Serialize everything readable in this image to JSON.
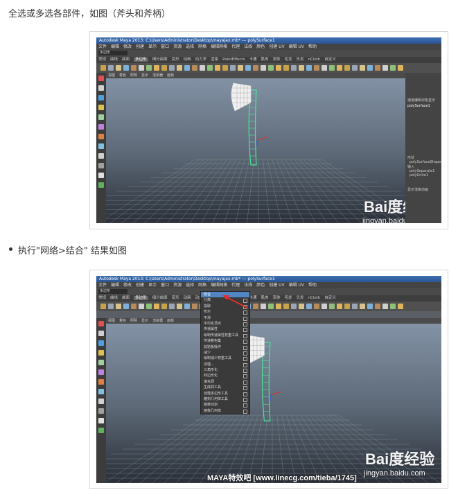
{
  "doc": {
    "line1": "全选或多选各部件，如图（斧头和斧柄）",
    "line2": "执行\"网络>结合\" 结果如图"
  },
  "shot1": {
    "title": "Autodesk Maya 2013: C:\\Users\\Administrator\\Desktop\\mayajax.mb* --- polySurface1",
    "menus": [
      "文件",
      "编辑",
      "修改",
      "创建",
      "显示",
      "窗口",
      "资源",
      "选择",
      "网格",
      "编辑网格",
      "代理",
      "法线",
      "颜色",
      "创建 UV",
      "编辑 UV",
      "帮助"
    ],
    "mode": "多边形",
    "tabs": [
      "常规",
      "曲线",
      "曲面",
      "多边形",
      "细分曲面",
      "变形",
      "动画",
      "动力学",
      "渲染",
      "PaintEffects",
      "卡通",
      "肌肉",
      "流体",
      "毛发",
      "头发",
      "nCloth",
      "自定义"
    ],
    "active_tab": "多边形",
    "vp_menus": [
      "视图",
      "着色",
      "照明",
      "显示",
      "渲染器",
      "面板"
    ],
    "panel_tabs": [
      "通道",
      "编辑",
      "对象",
      "显示"
    ],
    "object": "polySurface1",
    "shapes_label": "形状",
    "shape_name": "polySurfaceShape1",
    "inputs_label": "输入",
    "inputs": [
      "polySeparate1",
      "polyUnite1"
    ],
    "layer_tabs": [
      "显示",
      "渲染",
      "动画"
    ]
  },
  "shot2": {
    "title": "Autodesk Maya 2013: C:\\Users\\Administrator\\Desktop\\mayajax.mb* --- polySurface1",
    "menu_items": [
      "结合",
      "分离",
      "提取",
      "布尔",
      "平滑",
      "平均化顶点",
      "传递属性",
      "绘制传递属性权重工具",
      "传递着色集",
      "剪贴板操作",
      "减少",
      "绘制减少权重工具",
      "清理...",
      "三角形化",
      "四边形化",
      "填充洞",
      "生成洞工具",
      "创建多边形工具",
      "雕刻几何体工具",
      "镜像切割",
      "镜像几何体"
    ],
    "banner": "MAYA特效吧    [www.linecg.com/tieba/1745]"
  },
  "watermark": {
    "brand": "Bai度经验",
    "site": "jingyan.baidu.com"
  },
  "colors": {
    "mesh": "#4ee39a",
    "highlight": "#5285c4",
    "arrow": "#e0302a"
  }
}
